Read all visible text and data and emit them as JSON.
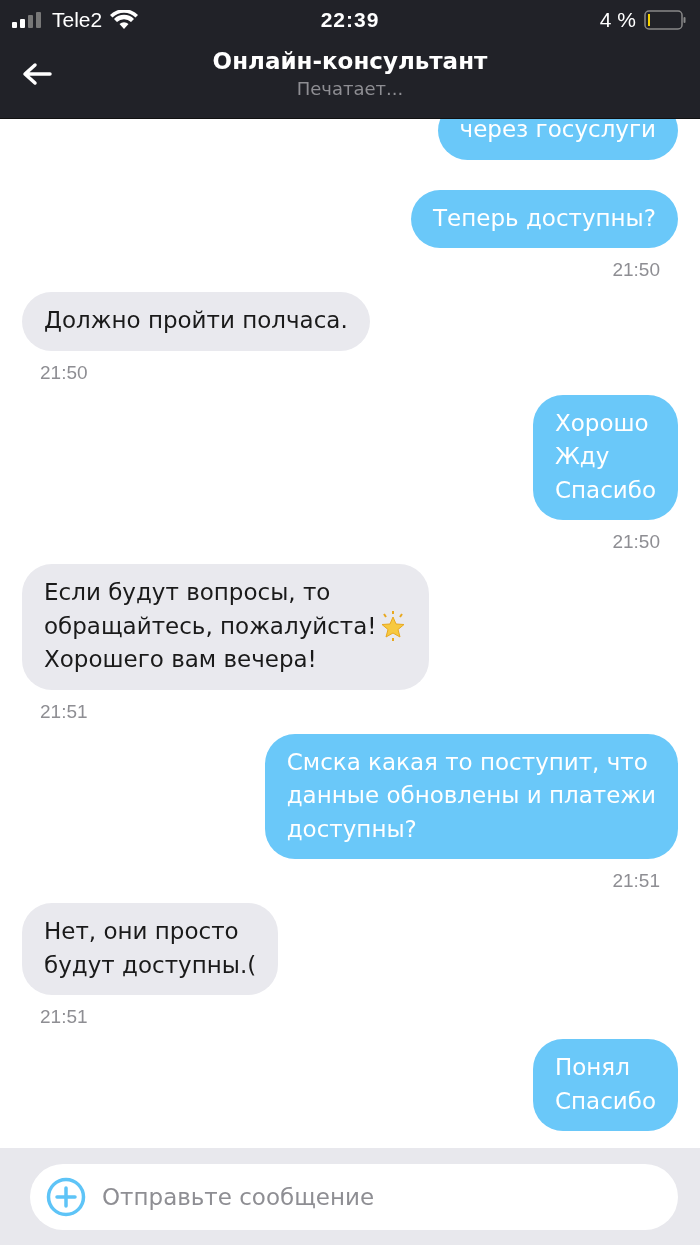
{
  "status_bar": {
    "carrier": "Tele2",
    "time": "22:39",
    "battery": "4 %"
  },
  "header": {
    "title": "Онлайн-консультант",
    "subtitle": "Печатает..."
  },
  "messages": [
    {
      "outgoing": true,
      "lines": [
        {
          "text": "через госуслуги",
          "star": false
        }
      ]
    },
    {
      "outgoing": true,
      "lines": [
        {
          "text": "Теперь доступны?",
          "star": false
        }
      ],
      "time": "21:50"
    },
    {
      "outgoing": false,
      "lines": [
        {
          "text": "Должно пройти полчаса.",
          "star": false
        }
      ],
      "time": "21:50"
    },
    {
      "outgoing": true,
      "lines": [
        {
          "text": "Хорошо",
          "star": false
        },
        {
          "text": "Жду",
          "star": false
        },
        {
          "text": "Спасибо",
          "star": false
        }
      ],
      "time": "21:50"
    },
    {
      "outgoing": false,
      "lines": [
        {
          "text": "Если будут вопросы, то",
          "star": false
        },
        {
          "text": "обращайтесь, пожалуйста!",
          "star": true
        },
        {
          "text": "Хорошего вам вечера!",
          "star": false
        }
      ],
      "time": "21:51"
    },
    {
      "outgoing": true,
      "lines": [
        {
          "text": "Смска какая то поступит, что",
          "star": false
        },
        {
          "text": "данные обновлены и платежи",
          "star": false
        },
        {
          "text": "доступны?",
          "star": false
        }
      ],
      "time": "21:51"
    },
    {
      "outgoing": false,
      "lines": [
        {
          "text": "Нет, они просто",
          "star": false
        },
        {
          "text": "будут доступны.(",
          "star": false
        }
      ],
      "time": "21:51"
    },
    {
      "outgoing": true,
      "lines": [
        {
          "text": "Понял",
          "star": false
        },
        {
          "text": "Спасибо",
          "star": false
        }
      ]
    }
  ],
  "composer": {
    "placeholder": "Отправьте сообщение"
  }
}
